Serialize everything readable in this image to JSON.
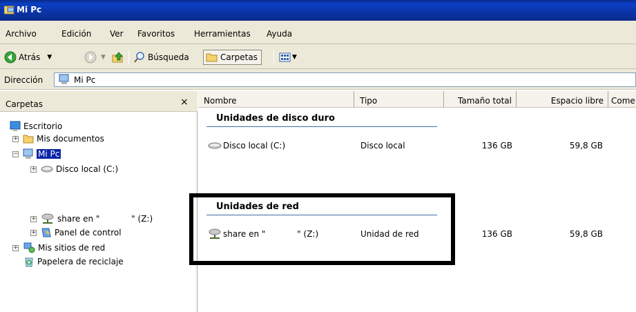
{
  "window": {
    "title": "Mi Pc"
  },
  "menu": [
    "Archivo",
    "Edición",
    "Ver",
    "Favoritos",
    "Herramientas",
    "Ayuda"
  ],
  "toolbar": {
    "back_label": "Atrás",
    "search_label": "Búsqueda",
    "folders_label": "Carpetas"
  },
  "address": {
    "label": "Dirección",
    "value": "Mi Pc"
  },
  "folders_pane": {
    "title": "Carpetas",
    "close_glyph": "×",
    "items": [
      {
        "label": "Escritorio",
        "icon": "desktop-icon"
      },
      {
        "label": "Mis documentos",
        "icon": "folder-icon"
      },
      {
        "label": "Mi Pc",
        "icon": "computer-icon",
        "selected": true
      },
      {
        "label": "Disco local (C:)",
        "icon": "drive-icon"
      },
      {
        "label": "share en \"            \" (Z:)",
        "icon": "network-drive-icon"
      },
      {
        "label": "Panel de control",
        "icon": "control-panel-icon"
      },
      {
        "label": "Mis sitios de red",
        "icon": "network-places-icon"
      },
      {
        "label": "Papelera de reciclaje",
        "icon": "recycle-bin-icon"
      }
    ]
  },
  "columns": {
    "name": "Nombre",
    "type": "Tipo",
    "total": "Tamaño total",
    "free": "Espacio libre",
    "comments": "Come"
  },
  "groups": [
    {
      "title": "Unidades de disco duro",
      "items": [
        {
          "name": "Disco local (C:)",
          "type": "Disco local",
          "total": "136 GB",
          "free": "59,8 GB",
          "icon": "drive-icon"
        }
      ]
    },
    {
      "title": "Unidades de red",
      "items": [
        {
          "name": "share en \"            \" (Z:)",
          "type": "Unidad de red",
          "total": "136 GB",
          "free": "59,8 GB",
          "icon": "network-drive-icon"
        }
      ]
    }
  ],
  "colors": {
    "titlebar": "#0a2a8a",
    "chrome": "#ece9d8",
    "selection": "#0a24a8",
    "accent_line": "#3a6ea5"
  }
}
